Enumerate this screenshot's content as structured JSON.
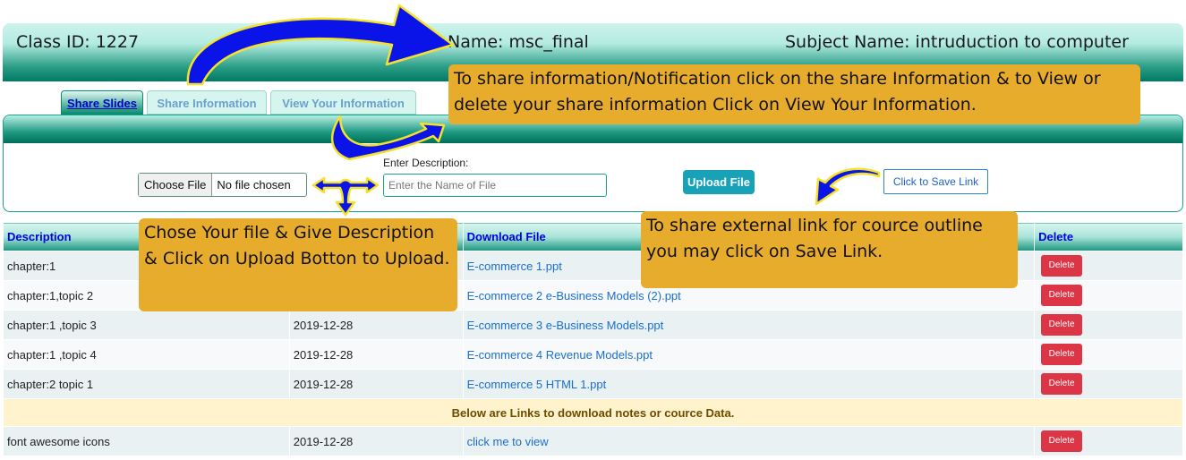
{
  "header": {
    "class_id": "Class ID: 1227",
    "class_name": "Name: msc_final",
    "subject_name": "Subject Name: intruduction to computer"
  },
  "tabs": [
    {
      "label": "Share Slides",
      "active": true
    },
    {
      "label": "Share Information",
      "active": false
    },
    {
      "label": "View Your Information",
      "active": false
    }
  ],
  "upload": {
    "choose_file_label": "Choose File",
    "file_status": "No file chosen",
    "description_label": "Enter Description:",
    "description_placeholder": "Enter the Name of File",
    "upload_button": "Upload File",
    "save_link_button": "Click to Save Link"
  },
  "table": {
    "headers": [
      "Description",
      "",
      "Download File",
      "Delete"
    ],
    "rows": [
      {
        "description": "chapter:1",
        "date": "",
        "file": "E-commerce 1.ppt",
        "delete": "Delete"
      },
      {
        "description": "chapter:1,topic 2",
        "date": "",
        "file": "E-commerce 2 e-Business Models (2).ppt",
        "delete": "Delete"
      },
      {
        "description": "chapter:1 ,topic 3",
        "date": "2019-12-28",
        "file": "E-commerce 3 e-Business Models.ppt",
        "delete": "Delete"
      },
      {
        "description": "chapter:1 ,topic 4",
        "date": "2019-12-28",
        "file": "E-commerce 4 Revenue Models.ppt",
        "delete": "Delete"
      },
      {
        "description": "chapter:2 topic 1",
        "date": "2019-12-28",
        "file": "E-commerce 5 HTML 1.ppt",
        "delete": "Delete"
      }
    ],
    "links_notice": "Below are Links to download notes or cource Data.",
    "link_rows": [
      {
        "description": "font awesome icons",
        "date": "2019-12-28",
        "file": "click me to view",
        "delete": "Delete"
      }
    ]
  },
  "callouts": {
    "share_info": "To share information/Notification click on the share Information & to View or delete your share information Click on View Your Information.",
    "upload_help": "Chose Your file  & Give Description & Click on Upload Botton to Upload.",
    "save_link_help": "To share external link for cource outline you may click on Save Link."
  },
  "colors": {
    "accent_teal": "#0b8c72",
    "callout": "#e8ac2c",
    "arrow": "#0a14e8",
    "delete_red": "#dc3545",
    "upload_btn": "#17a2b8"
  }
}
